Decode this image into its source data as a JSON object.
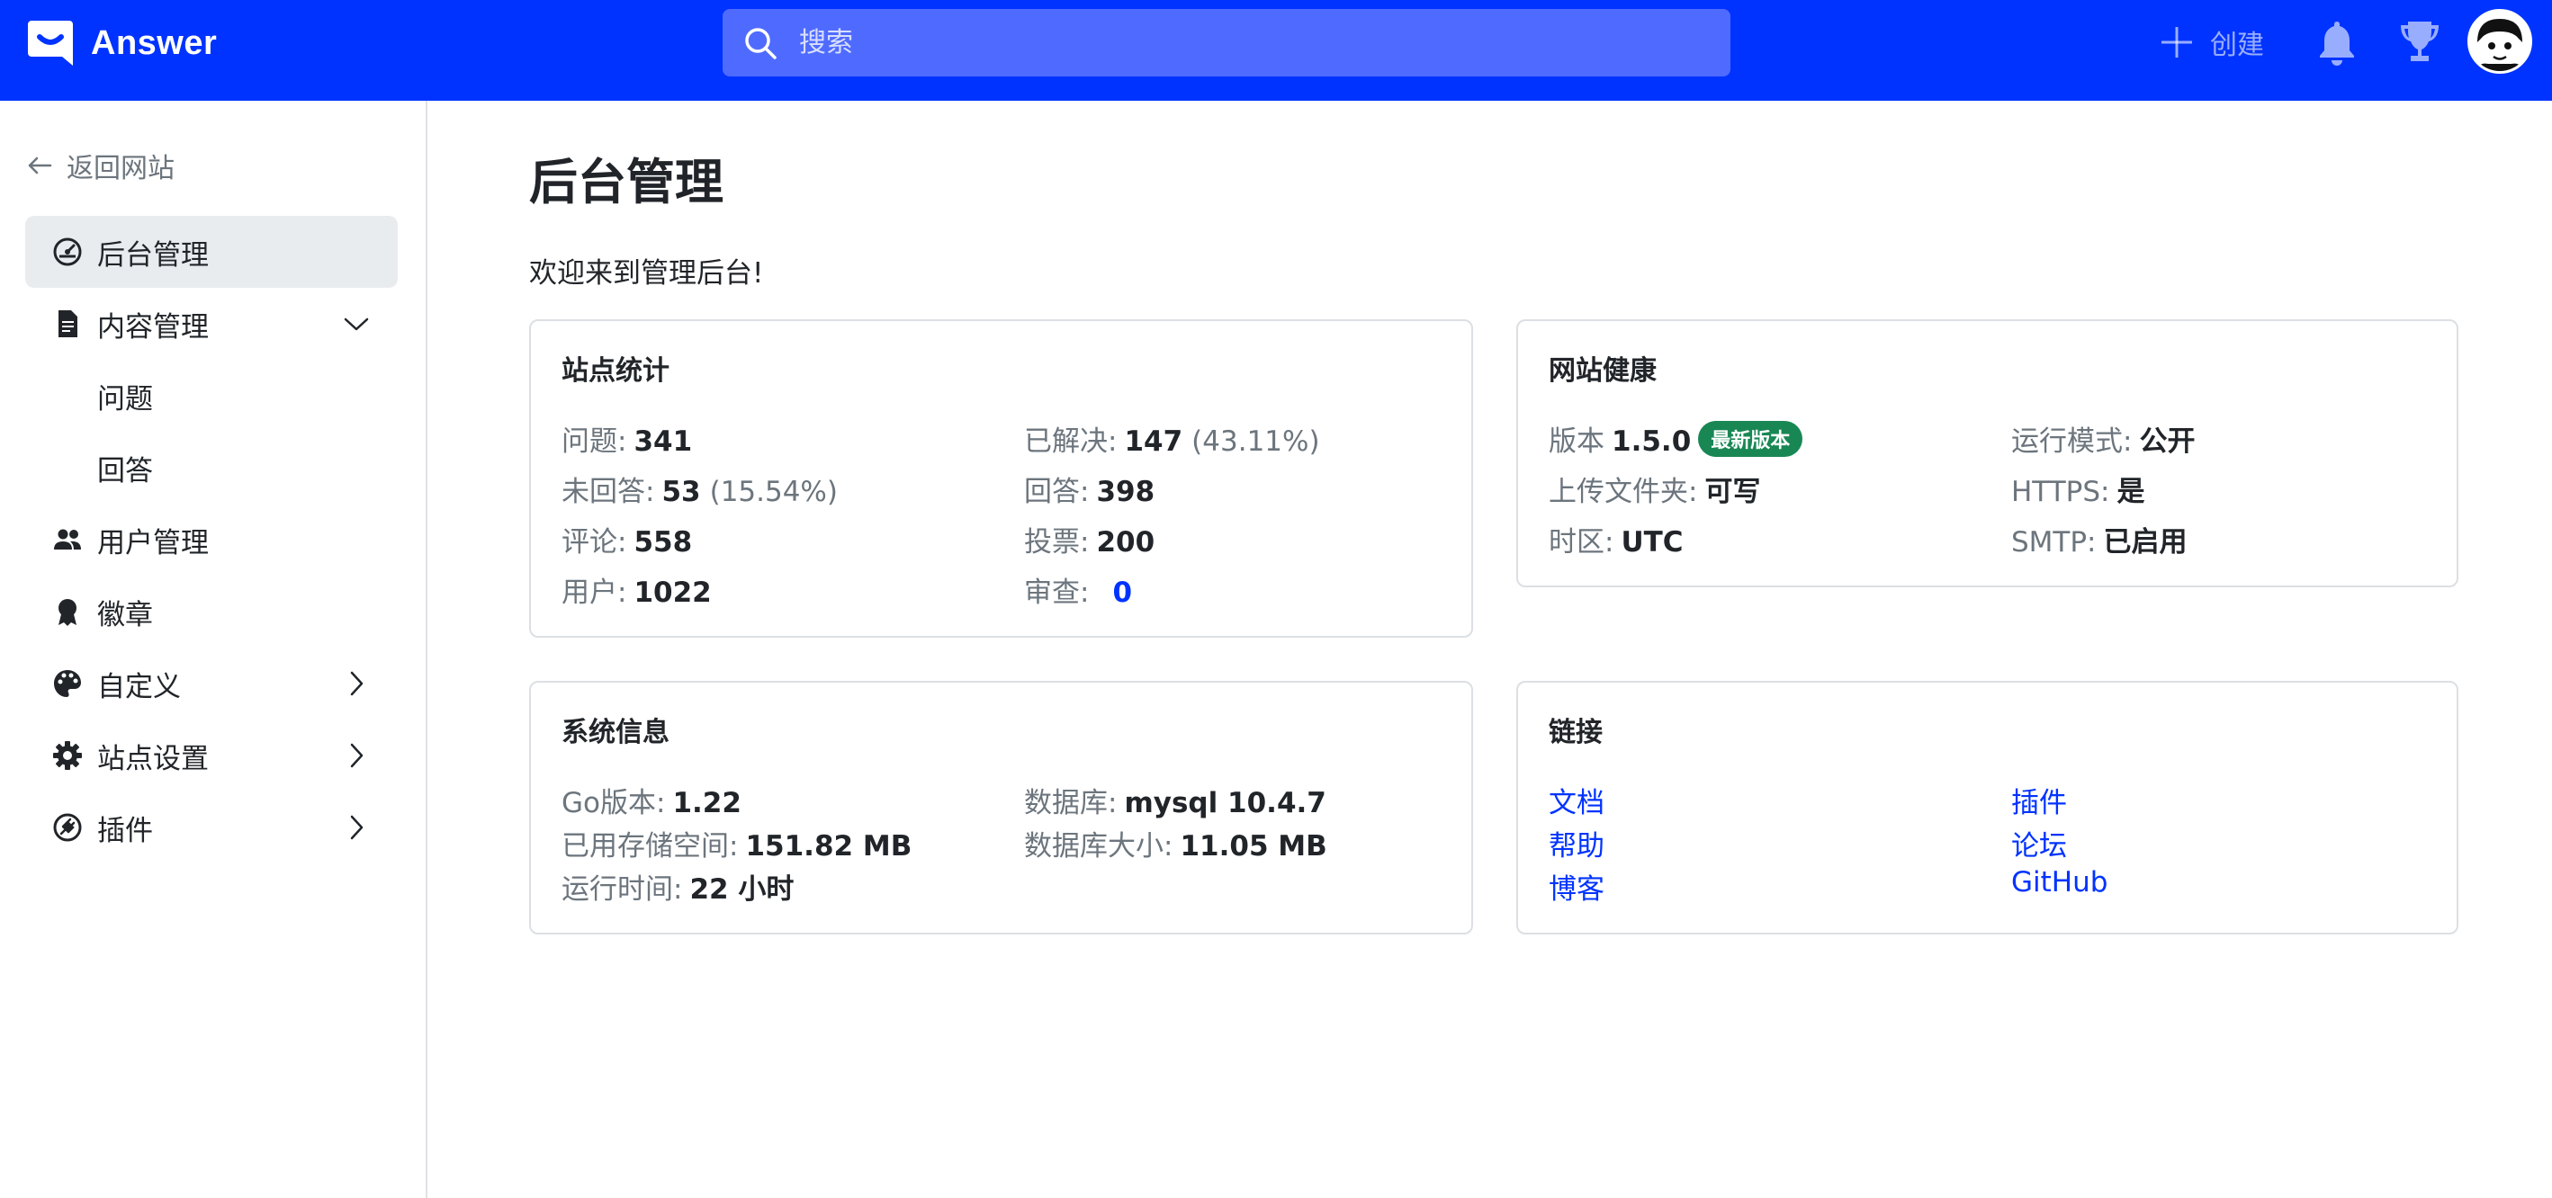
{
  "header": {
    "brand": "Answer",
    "search_placeholder": "搜索",
    "create_label": "创建"
  },
  "sidebar": {
    "back_label": "返回网站",
    "items": [
      {
        "label": "后台管理",
        "icon": "speedometer-icon",
        "active": true
      },
      {
        "label": "内容管理",
        "icon": "file-text-icon",
        "expanded": true,
        "children": [
          {
            "label": "问题"
          },
          {
            "label": "回答"
          }
        ]
      },
      {
        "label": "用户管理",
        "icon": "people-icon"
      },
      {
        "label": "徽章",
        "icon": "award-icon"
      },
      {
        "label": "自定义",
        "icon": "palette-icon"
      },
      {
        "label": "站点设置",
        "icon": "gear-icon"
      },
      {
        "label": "插件",
        "icon": "plugin-icon"
      }
    ]
  },
  "main": {
    "title": "后台管理",
    "welcome": "欢迎来到管理后台!",
    "stats": {
      "title": "站点统计",
      "questions_label": "问题:",
      "questions": "341",
      "resolved_label": "已解决:",
      "resolved": "147",
      "resolved_pct": "(43.11%)",
      "unanswered_label": "未回答:",
      "unanswered": "53",
      "unanswered_pct": "(15.54%)",
      "answers_label": "回答:",
      "answers": "398",
      "comments_label": "评论:",
      "comments": "558",
      "votes_label": "投票:",
      "votes": "200",
      "users_label": "用户:",
      "users": "1022",
      "review_label": "审查:",
      "review": "0"
    },
    "health": {
      "title": "网站健康",
      "version_label": "版本",
      "version": "1.5.0",
      "version_badge": "最新版本",
      "mode_label": "运行模式:",
      "mode": "公开",
      "upload_label": "上传文件夹:",
      "upload": "可写",
      "https_label": "HTTPS:",
      "https": "是",
      "timezone_label": "时区:",
      "timezone": "UTC",
      "smtp_label": "SMTP:",
      "smtp": "已启用"
    },
    "system": {
      "title": "系统信息",
      "go_label": "Go版本:",
      "go": "1.22",
      "db_label": "数据库:",
      "db": "mysql 10.4.7",
      "storage_label": "已用存储空间:",
      "storage": "151.82 MB",
      "dbsize_label": "数据库大小:",
      "dbsize": "11.05 MB",
      "uptime_label": "运行时间:",
      "uptime": "22 小时"
    },
    "links": {
      "title": "链接",
      "docs": "文档",
      "help": "帮助",
      "blog": "博客",
      "plugins": "插件",
      "forum": "论坛",
      "github": "GitHub"
    }
  },
  "colors": {
    "brand_blue": "#0033ff",
    "badge_green": "#198754"
  }
}
